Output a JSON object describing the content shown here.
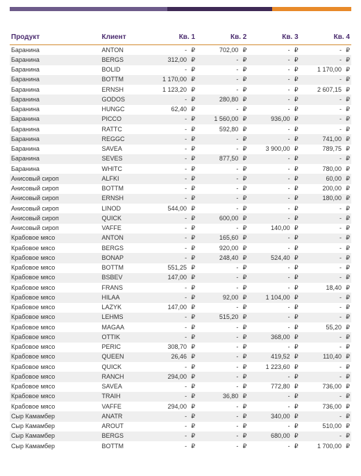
{
  "currency": "₽",
  "placeholder": "-",
  "headers": {
    "product": "Продукт",
    "client": "Клиент",
    "q1": "Кв. 1",
    "q2": "Кв. 2",
    "q3": "Кв. 3",
    "q4": "Кв. 4"
  },
  "rows": [
    {
      "product": "Баранина",
      "client": "ANTON",
      "q1": null,
      "q2": "702,00",
      "q3": null,
      "q4": null
    },
    {
      "product": "Баранина",
      "client": "BERGS",
      "q1": "312,00",
      "q2": null,
      "q3": null,
      "q4": null
    },
    {
      "product": "Баранина",
      "client": "BOLID",
      "q1": null,
      "q2": null,
      "q3": null,
      "q4": "1 170,00"
    },
    {
      "product": "Баранина",
      "client": "BOTTM",
      "q1": "1 170,00",
      "q2": null,
      "q3": null,
      "q4": null
    },
    {
      "product": "Баранина",
      "client": "ERNSH",
      "q1": "1 123,20",
      "q2": null,
      "q3": null,
      "q4": "2 607,15"
    },
    {
      "product": "Баранина",
      "client": "GODOS",
      "q1": null,
      "q2": "280,80",
      "q3": null,
      "q4": null
    },
    {
      "product": "Баранина",
      "client": "HUNGC",
      "q1": "62,40",
      "q2": null,
      "q3": null,
      "q4": null
    },
    {
      "product": "Баранина",
      "client": "PICCO",
      "q1": null,
      "q2": "1 560,00",
      "q3": "936,00",
      "q4": null
    },
    {
      "product": "Баранина",
      "client": "RATTC",
      "q1": null,
      "q2": "592,80",
      "q3": null,
      "q4": null
    },
    {
      "product": "Баранина",
      "client": "REGGC",
      "q1": null,
      "q2": null,
      "q3": null,
      "q4": "741,00"
    },
    {
      "product": "Баранина",
      "client": "SAVEA",
      "q1": null,
      "q2": null,
      "q3": "3 900,00",
      "q4": "789,75"
    },
    {
      "product": "Баранина",
      "client": "SEVES",
      "q1": null,
      "q2": "877,50",
      "q3": null,
      "q4": null
    },
    {
      "product": "Баранина",
      "client": "WHITC",
      "q1": null,
      "q2": null,
      "q3": null,
      "q4": "780,00"
    },
    {
      "product": "Анисовый сироп",
      "client": "ALFKI",
      "q1": null,
      "q2": null,
      "q3": null,
      "q4": "60,00"
    },
    {
      "product": "Анисовый сироп",
      "client": "BOTTM",
      "q1": null,
      "q2": null,
      "q3": null,
      "q4": "200,00"
    },
    {
      "product": "Анисовый сироп",
      "client": "ERNSH",
      "q1": null,
      "q2": null,
      "q3": null,
      "q4": "180,00"
    },
    {
      "product": "Анисовый сироп",
      "client": "LINOD",
      "q1": "544,00",
      "q2": null,
      "q3": null,
      "q4": null
    },
    {
      "product": "Анисовый сироп",
      "client": "QUICK",
      "q1": null,
      "q2": "600,00",
      "q3": null,
      "q4": null
    },
    {
      "product": "Анисовый сироп",
      "client": "VAFFE",
      "q1": null,
      "q2": null,
      "q3": "140,00",
      "q4": null
    },
    {
      "product": "Крабовое мясо",
      "client": "ANTON",
      "q1": null,
      "q2": "165,60",
      "q3": null,
      "q4": null
    },
    {
      "product": "Крабовое мясо",
      "client": "BERGS",
      "q1": null,
      "q2": "920,00",
      "q3": null,
      "q4": null
    },
    {
      "product": "Крабовое мясо",
      "client": "BONAP",
      "q1": null,
      "q2": "248,40",
      "q3": "524,40",
      "q4": null
    },
    {
      "product": "Крабовое мясо",
      "client": "BOTTM",
      "q1": "551,25",
      "q2": null,
      "q3": null,
      "q4": null
    },
    {
      "product": "Крабовое мясо",
      "client": "BSBEV",
      "q1": "147,00",
      "q2": null,
      "q3": null,
      "q4": null
    },
    {
      "product": "Крабовое мясо",
      "client": "FRANS",
      "q1": null,
      "q2": null,
      "q3": null,
      "q4": "18,40"
    },
    {
      "product": "Крабовое мясо",
      "client": "HILAA",
      "q1": null,
      "q2": "92,00",
      "q3": "1 104,00",
      "q4": null
    },
    {
      "product": "Крабовое мясо",
      "client": "LAZYK",
      "q1": "147,00",
      "q2": null,
      "q3": null,
      "q4": null
    },
    {
      "product": "Крабовое мясо",
      "client": "LEHMS",
      "q1": null,
      "q2": "515,20",
      "q3": null,
      "q4": null
    },
    {
      "product": "Крабовое мясо",
      "client": "MAGAA",
      "q1": null,
      "q2": null,
      "q3": null,
      "q4": "55,20"
    },
    {
      "product": "Крабовое мясо",
      "client": "OTTIK",
      "q1": null,
      "q2": null,
      "q3": "368,00",
      "q4": null
    },
    {
      "product": "Крабовое мясо",
      "client": "PERIC",
      "q1": "308,70",
      "q2": null,
      "q3": null,
      "q4": null
    },
    {
      "product": "Крабовое мясо",
      "client": "QUEEN",
      "q1": "26,46",
      "q2": null,
      "q3": "419,52",
      "q4": "110,40"
    },
    {
      "product": "Крабовое мясо",
      "client": "QUICK",
      "q1": null,
      "q2": null,
      "q3": "1 223,60",
      "q4": null
    },
    {
      "product": "Крабовое мясо",
      "client": "RANCH",
      "q1": "294,00",
      "q2": null,
      "q3": null,
      "q4": null
    },
    {
      "product": "Крабовое мясо",
      "client": "SAVEA",
      "q1": null,
      "q2": null,
      "q3": "772,80",
      "q4": "736,00"
    },
    {
      "product": "Крабовое мясо",
      "client": "TRAIH",
      "q1": null,
      "q2": "36,80",
      "q3": null,
      "q4": null
    },
    {
      "product": "Крабовое мясо",
      "client": "VAFFE",
      "q1": "294,00",
      "q2": null,
      "q3": null,
      "q4": "736,00"
    },
    {
      "product": "Сыр Камамбер",
      "client": "ANATR",
      "q1": null,
      "q2": null,
      "q3": "340,00",
      "q4": null
    },
    {
      "product": "Сыр Камамбер",
      "client": "AROUT",
      "q1": null,
      "q2": null,
      "q3": null,
      "q4": "510,00"
    },
    {
      "product": "Сыр Камамбер",
      "client": "BERGS",
      "q1": null,
      "q2": null,
      "q3": "680,00",
      "q4": null
    },
    {
      "product": "Сыр Камамбер",
      "client": "BOTTM",
      "q1": null,
      "q2": null,
      "q3": null,
      "q4": "1 700,00"
    }
  ]
}
